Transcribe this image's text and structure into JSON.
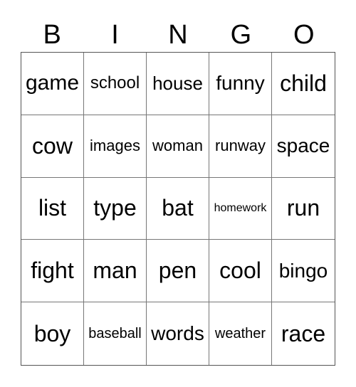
{
  "header": {
    "letters": [
      "B",
      "I",
      "N",
      "G",
      "O"
    ]
  },
  "grid": {
    "rows": [
      [
        "game",
        "school",
        "house",
        "funny",
        "child"
      ],
      [
        "cow",
        "images",
        "woman",
        "runway",
        "space"
      ],
      [
        "list",
        "type",
        "bat",
        "homework",
        "run"
      ],
      [
        "fight",
        "man",
        "pen",
        "cool",
        "bingo"
      ],
      [
        "boy",
        "baseball",
        "words",
        "weather",
        "race"
      ]
    ]
  }
}
